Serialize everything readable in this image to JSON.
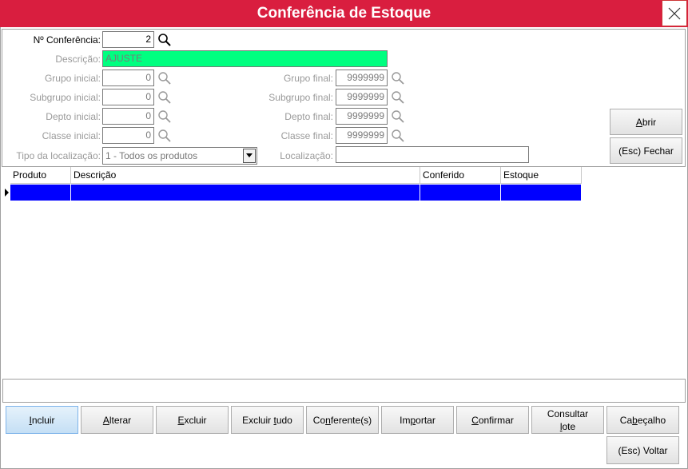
{
  "window": {
    "title": "Conferência de Estoque"
  },
  "form": {
    "numero_label": "Nº Conferência:",
    "numero_value": "2",
    "descricao_label": "Descrição:",
    "descricao_value": "AJUSTE",
    "grupo_inicial_label": "Grupo inicial:",
    "grupo_inicial_value": "0",
    "grupo_final_label": "Grupo final:",
    "grupo_final_value": "9999999",
    "subgrupo_inicial_label": "Subgrupo inicial:",
    "subgrupo_inicial_value": "0",
    "subgrupo_final_label": "Subgrupo final:",
    "subgrupo_final_value": "9999999",
    "depto_inicial_label": "Depto inicial:",
    "depto_inicial_value": "0",
    "depto_final_label": "Depto final:",
    "depto_final_value": "9999999",
    "classe_inicial_label": "Classe inicial:",
    "classe_inicial_value": "0",
    "classe_final_label": "Classe final:",
    "classe_final_value": "9999999",
    "tipo_label": "Tipo da localização:",
    "tipo_value": "1 - Todos os produtos",
    "localizacao_label": "Localização:",
    "localizacao_value": ""
  },
  "side_buttons": {
    "abrir": {
      "pre": "",
      "u": "A",
      "post": "brir"
    },
    "fechar": "(Esc) Fechar"
  },
  "grid": {
    "columns": [
      "Produto",
      "Descrição",
      "Conferido",
      "Estoque"
    ]
  },
  "footer_buttons": [
    {
      "pre": "",
      "u": "I",
      "post": "ncluir"
    },
    {
      "pre": "",
      "u": "A",
      "post": "lterar"
    },
    {
      "pre": "",
      "u": "E",
      "post": "xcluir"
    },
    {
      "pre": "Excluir ",
      "u": "t",
      "post": "udo"
    },
    {
      "pre": "Co",
      "u": "n",
      "post": "ferente(s)"
    },
    {
      "pre": "Im",
      "u": "p",
      "post": "ortar"
    },
    {
      "pre": "",
      "u": "C",
      "post": "onfirmar"
    },
    {
      "pre": "Consultar",
      "u": "l",
      "post": "ote"
    },
    {
      "pre": "Ca",
      "u": "b",
      "post": "eçalho"
    }
  ],
  "voltar_button": "(Esc) Voltar",
  "colors": {
    "titlebar": "#d91e3f",
    "descricao_bg": "#00ff80",
    "grid_selected_row": "#0000ff"
  },
  "icons": [
    "close-icon",
    "search-icon",
    "chevron-down-icon",
    "row-pointer-icon"
  ]
}
